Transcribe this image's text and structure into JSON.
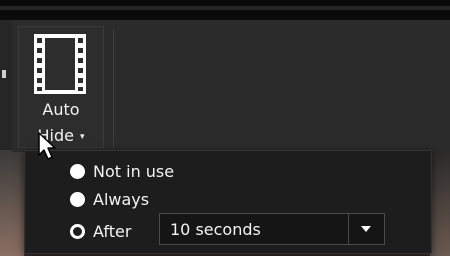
{
  "ribbon": {
    "auto_hide": {
      "label_line1": "Auto",
      "label_line2": "Hide",
      "caret": "▾",
      "icon": "film-strip-icon"
    }
  },
  "dropdown": {
    "options": [
      {
        "label": "Not in use",
        "selected": false
      },
      {
        "label": "Always",
        "selected": false
      },
      {
        "label": "After",
        "selected": true
      }
    ],
    "after_select": {
      "value": "10 seconds"
    }
  },
  "colors": {
    "panel_bg": "#1d1d1d",
    "ribbon_bg": "#2b2b2b",
    "text": "#f3f3f3"
  }
}
